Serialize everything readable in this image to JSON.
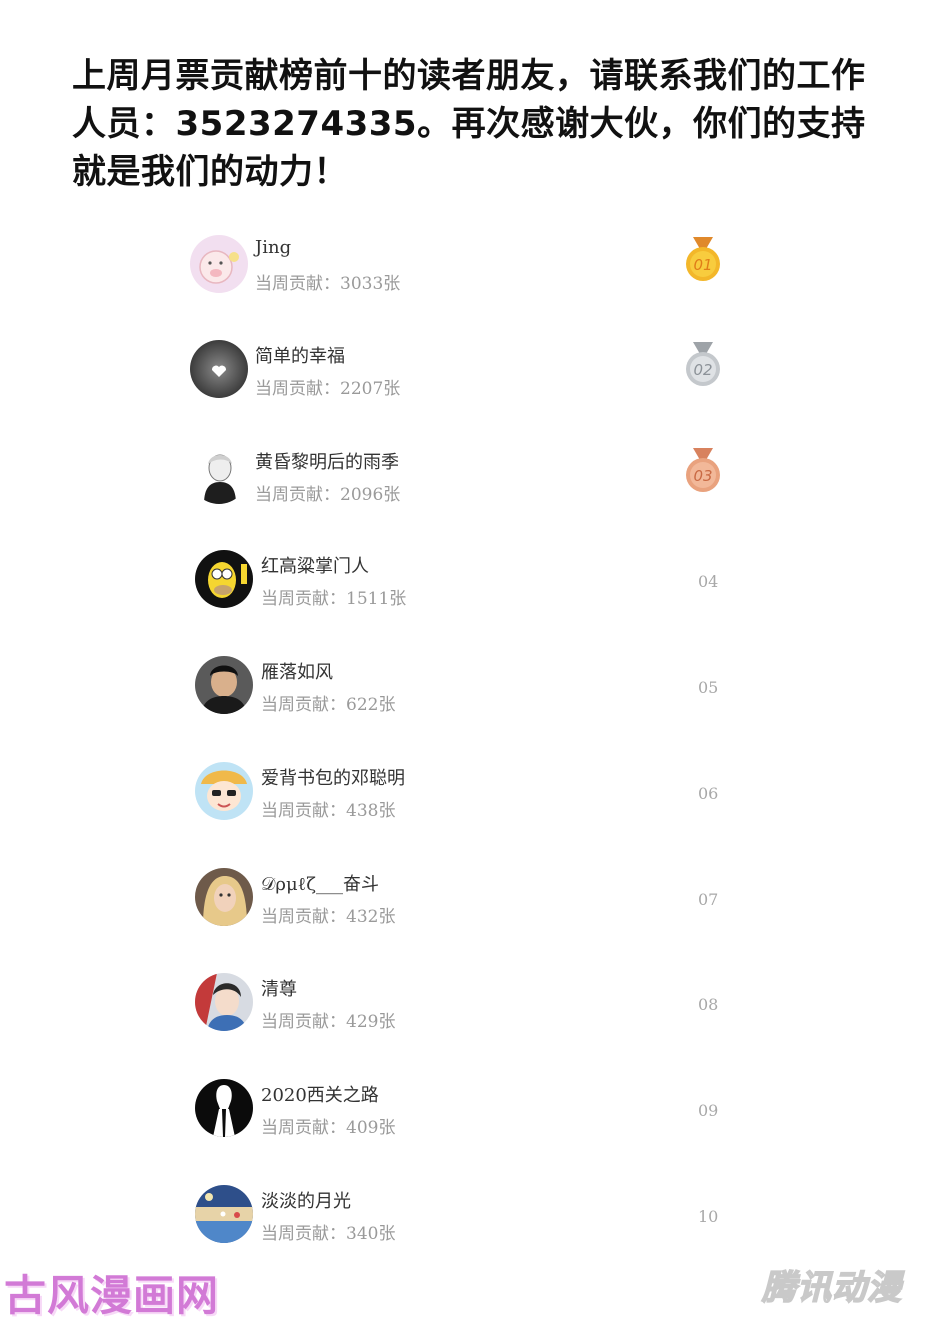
{
  "announcement": "上周月票贡献榜前十的读者朋友，请联系我们的工作人员：3523274335。再次感谢大伙，你们的支持就是我们的动力！",
  "contribution_prefix": "当周贡献：",
  "unit": "张",
  "ranking": [
    {
      "name": "Jing",
      "amount": "3033",
      "rank": "01",
      "medal": "gold"
    },
    {
      "name": "简单的幸福",
      "amount": "2207",
      "rank": "02",
      "medal": "silver"
    },
    {
      "name": "黄昏黎明后的雨季",
      "amount": "2096",
      "rank": "03",
      "medal": "bronze"
    },
    {
      "name": "红高粱掌门人",
      "amount": "1511",
      "rank": "04"
    },
    {
      "name": "雁落如风",
      "amount": "622",
      "rank": "05"
    },
    {
      "name": "爱背书包的邓聪明",
      "amount": "438",
      "rank": "06"
    },
    {
      "name": "𝒟ρμℓζ___奋斗",
      "amount": "432",
      "rank": "07"
    },
    {
      "name": "清尊",
      "amount": "429",
      "rank": "08"
    },
    {
      "name": "2020西关之路",
      "amount": "409",
      "rank": "09"
    },
    {
      "name": "淡淡的月光",
      "amount": "340",
      "rank": "10"
    }
  ],
  "watermark_left": "古风漫画网",
  "watermark_right": "腾讯动漫",
  "colors": {
    "gold": "#f3b72a",
    "silver": "#c4c8cc",
    "bronze": "#e9a27e",
    "watermark_left": "#d27ad6"
  }
}
